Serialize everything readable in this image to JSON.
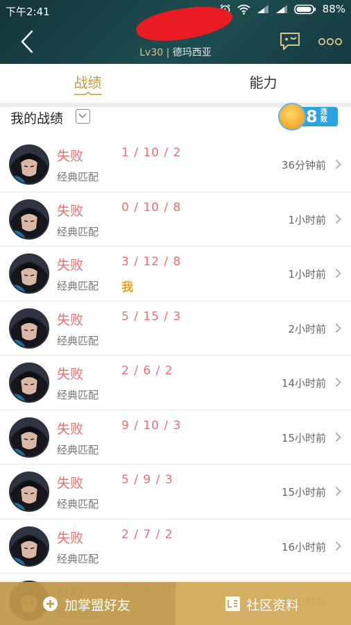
{
  "status_bar": {
    "time": "下午2:41",
    "battery": "88%"
  },
  "header": {
    "level": "Lv30",
    "separator": " | ",
    "server": "德玛西亚"
  },
  "tabs": [
    {
      "label": "战绩",
      "active": true
    },
    {
      "label": "能力",
      "active": false
    }
  ],
  "my_record": {
    "title": "我的战绩",
    "streak": {
      "count": "8",
      "label": "连败"
    }
  },
  "matches": [
    {
      "result": "失败",
      "mode": "经典匹配",
      "kda": "1 / 10 / 2",
      "time": "36分钟前",
      "badge": ""
    },
    {
      "result": "失败",
      "mode": "经典匹配",
      "kda": "0 / 10 / 8",
      "time": "1小时前",
      "badge": ""
    },
    {
      "result": "失败",
      "mode": "经典匹配",
      "kda": "3 / 12 / 8",
      "time": "1小时前",
      "badge": "我"
    },
    {
      "result": "失败",
      "mode": "经典匹配",
      "kda": "5 / 15 / 3",
      "time": "2小时前",
      "badge": ""
    },
    {
      "result": "失败",
      "mode": "经典匹配",
      "kda": "2 / 6 / 2",
      "time": "14小时前",
      "badge": ""
    },
    {
      "result": "失败",
      "mode": "经典匹配",
      "kda": "9 / 10 / 3",
      "time": "15小时前",
      "badge": ""
    },
    {
      "result": "失败",
      "mode": "经典匹配",
      "kda": "5 / 9 / 3",
      "time": "15小时前",
      "badge": ""
    },
    {
      "result": "失败",
      "mode": "经典匹配",
      "kda": "2 / 7 / 2",
      "time": "16小时前",
      "badge": ""
    },
    {
      "result": "胜利",
      "mode": "经典匹配",
      "kda": "3 / 6 / 19",
      "time": "16小时前",
      "badge": ""
    }
  ],
  "bottom_bar": {
    "add_friend": "加掌盟好友",
    "community": "社区资料"
  },
  "colors": {
    "header_bg": "#1d4d50",
    "accent_gold": "#c29d3e",
    "loss_red": "#f06f6f",
    "bottom_left": "#bf994a",
    "bottom_right": "#d2ab5c"
  },
  "icons": {
    "back": "chevron-left-icon",
    "chat": "chat-bubble-icon",
    "more": "more-dots-icon",
    "dropdown": "chevron-down-icon",
    "row": "chevron-right-icon",
    "add": "plus-circle-icon",
    "community": "document-icon"
  }
}
